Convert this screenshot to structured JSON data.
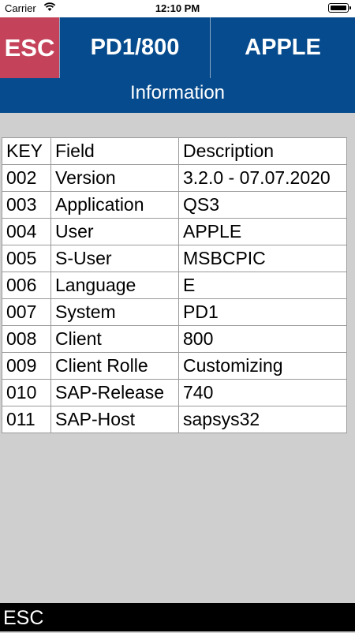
{
  "status_bar": {
    "carrier": "Carrier",
    "time": "12:10 PM",
    "battery_percent": 100
  },
  "header": {
    "esc_label": "ESC",
    "system": "PD1/800",
    "user": "APPLE",
    "subtitle": "Information"
  },
  "table": {
    "headers": [
      "KEY",
      "Field",
      "Description"
    ],
    "rows": [
      [
        "002",
        "Version",
        "3.2.0 - 07.07.2020"
      ],
      [
        "003",
        "Application",
        "QS3"
      ],
      [
        "004",
        "User",
        "APPLE"
      ],
      [
        "005",
        "S-User",
        "MSBCPIC"
      ],
      [
        "006",
        "Language",
        "E"
      ],
      [
        "007",
        "System",
        "PD1"
      ],
      [
        "008",
        "Client",
        "800"
      ],
      [
        "009",
        "Client Rolle",
        "Customizing"
      ],
      [
        "010",
        "SAP-Release",
        "740"
      ],
      [
        "011",
        "SAP-Host",
        "sapsys32"
      ]
    ]
  },
  "footer": {
    "label": "ESC"
  }
}
